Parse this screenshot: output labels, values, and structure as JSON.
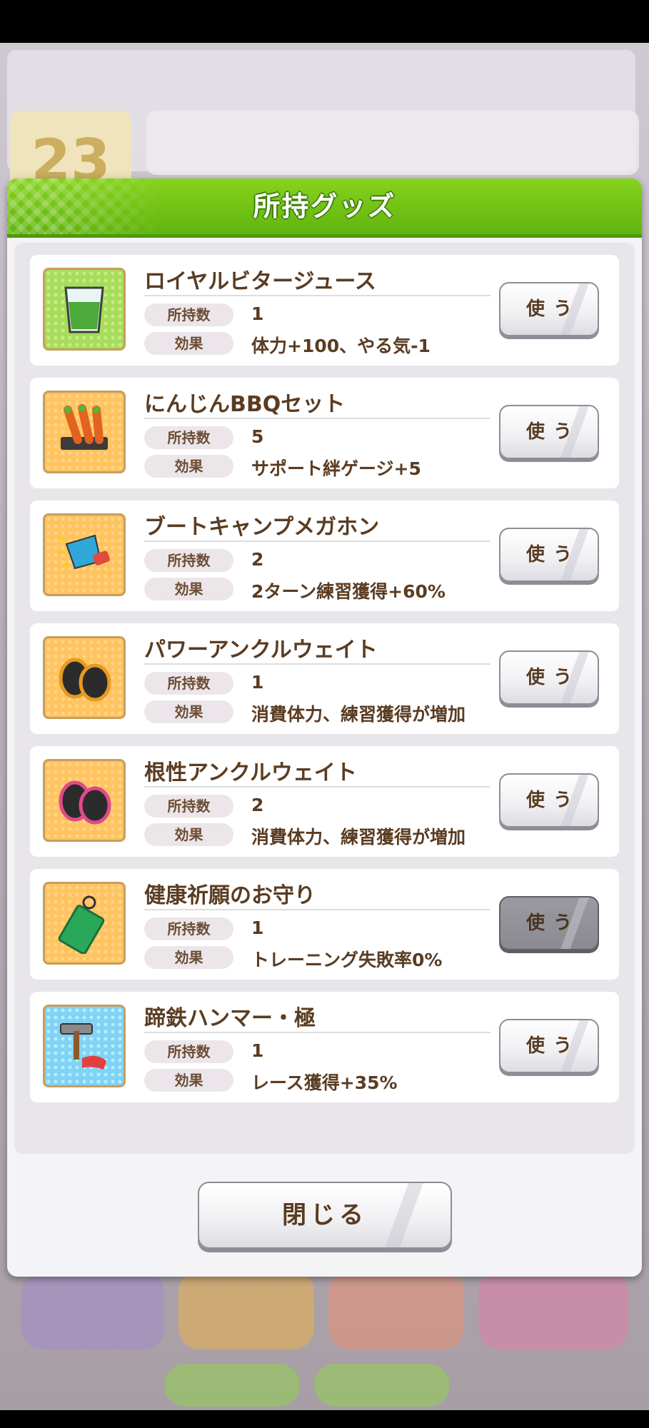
{
  "dialog": {
    "title": "所持グッズ",
    "close_label": "閉じる",
    "count_label": "所持数",
    "effect_label": "効果",
    "use_label": "使う"
  },
  "items": [
    {
      "name": "ロイヤルビタージュース",
      "count": "1",
      "effect": "体力+100、やる気-1",
      "icon": "green-juice-glass-icon",
      "use_enabled": true
    },
    {
      "name": "にんじんBBQセット",
      "count": "5",
      "effect": "サポート絆ゲージ+5",
      "icon": "carrot-bbq-icon",
      "use_enabled": true
    },
    {
      "name": "ブートキャンプメガホン",
      "count": "2",
      "effect": "2ターン練習獲得+60%",
      "icon": "megaphone-icon",
      "use_enabled": true
    },
    {
      "name": "パワーアンクルウェイト",
      "count": "1",
      "effect": "消費体力、練習獲得が増加",
      "icon": "ankle-weight-orange-icon",
      "use_enabled": true
    },
    {
      "name": "根性アンクルウェイト",
      "count": "2",
      "effect": "消費体力、練習獲得が増加",
      "icon": "ankle-weight-pink-icon",
      "use_enabled": true
    },
    {
      "name": "健康祈願のお守り",
      "count": "1",
      "effect": "トレーニング失敗率0%",
      "icon": "omamori-charm-icon",
      "use_enabled": false
    },
    {
      "name": "蹄鉄ハンマー・極",
      "count": "1",
      "effect": "レース獲得+35%",
      "icon": "horseshoe-hammer-icon",
      "use_enabled": true
    }
  ],
  "background": {
    "day_number": "23"
  }
}
